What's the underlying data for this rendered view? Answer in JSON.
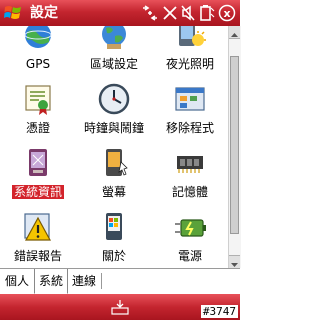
{
  "title_bar": {
    "title": "設定",
    "icons": [
      "start-icon",
      "connectivity-icon",
      "signal-icon",
      "volume-icon",
      "battery-icon",
      "close-icon"
    ],
    "close_label": "x"
  },
  "items": [
    {
      "name": "gps",
      "label": "GPS",
      "icon": "gps-icon"
    },
    {
      "name": "regional-settings",
      "label": "區域設定",
      "icon": "globe-icon"
    },
    {
      "name": "backlight",
      "label": "夜光照明",
      "icon": "backlight-icon"
    },
    {
      "name": "certificates",
      "label": "憑證",
      "icon": "certificate-icon"
    },
    {
      "name": "clock-alarms",
      "label": "時鐘與鬧鐘",
      "icon": "clock-icon"
    },
    {
      "name": "remove-programs",
      "label": "移除程式",
      "icon": "remove-programs-icon"
    },
    {
      "name": "system-info",
      "label": "系統資訊",
      "icon": "system-info-icon",
      "selected": true
    },
    {
      "name": "screen",
      "label": "螢幕",
      "icon": "screen-icon"
    },
    {
      "name": "memory",
      "label": "記憶體",
      "icon": "memory-icon"
    },
    {
      "name": "error-reporting",
      "label": "錯誤報告",
      "icon": "error-report-icon"
    },
    {
      "name": "about",
      "label": "關於",
      "icon": "about-icon"
    },
    {
      "name": "power",
      "label": "電源",
      "icon": "power-icon"
    }
  ],
  "tabs": [
    {
      "label": "個人",
      "active": false
    },
    {
      "label": "系統",
      "active": true
    },
    {
      "label": "連線",
      "active": false
    }
  ],
  "bottom_bar": {
    "keyboard_icon": "keyboard-icon",
    "corner_id": "#3747"
  },
  "colors": {
    "title_bar": "#c4252f",
    "selection": "#d3232b"
  }
}
